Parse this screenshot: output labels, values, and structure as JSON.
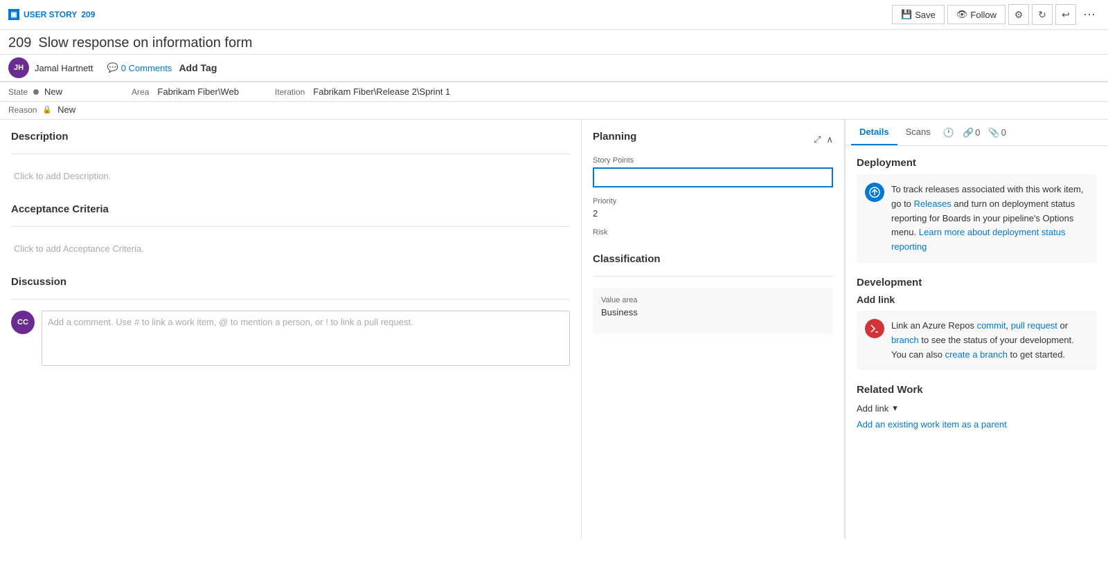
{
  "workItem": {
    "type": "USER STORY",
    "number": "209",
    "title": "Slow response on information form",
    "assignee": "Jamal Hartnett",
    "assigneeInitials": "JH",
    "commentsCount": "0 Comments",
    "addTagLabel": "Add Tag"
  },
  "state": {
    "label": "State",
    "dot": true,
    "value": "New",
    "reasonLabel": "Reason",
    "reasonIcon": "lock",
    "reasonValue": "New",
    "areaLabel": "Area",
    "areaValue": "Fabrikam Fiber\\Web",
    "iterationLabel": "Iteration",
    "iterationValue": "Fabrikam Fiber\\Release 2\\Sprint 1"
  },
  "toolbar": {
    "saveLabel": "Save",
    "followLabel": "Follow",
    "settingsIcon": "⚙",
    "refreshIcon": "↻",
    "undoIcon": "↩",
    "moreIcon": "⋯"
  },
  "tabs": {
    "details": "Details",
    "scans": "Scans",
    "history": "🕐",
    "links": "0",
    "attachments": "0"
  },
  "description": {
    "title": "Description",
    "placeholder": "Click to add Description."
  },
  "acceptanceCriteria": {
    "title": "Acceptance Criteria",
    "placeholder": "Click to add Acceptance Criteria."
  },
  "discussion": {
    "title": "Discussion",
    "avatarInitials": "CC",
    "placeholder": "Add a comment. Use # to link a work item, @ to mention a person, or ! to link a pull request."
  },
  "planning": {
    "title": "Planning",
    "storyPointsLabel": "Story Points",
    "storyPointsValue": "",
    "priorityLabel": "Priority",
    "priorityValue": "2",
    "riskLabel": "Risk",
    "riskValue": ""
  },
  "classification": {
    "title": "Classification",
    "valueAreaLabel": "Value area",
    "valueAreaValue": "Business"
  },
  "deployment": {
    "sectionTitle": "Deployment",
    "bodyText": "To track releases associated with this work item, go to Releases and turn on deployment status reporting for Boards in your pipeline's Options menu. Learn more about deployment status reporting",
    "releasesLinkText": "Releases",
    "learnMoreText": "Learn more about deployment status reporting"
  },
  "development": {
    "sectionTitle": "Development",
    "addLinkLabel": "Add link",
    "bodyText": "Link an Azure Repos commit, pull request or branch to see the status of your development. You can also create a branch to get started.",
    "commitLinkText": "commit",
    "pullRequestLinkText": "pull request",
    "branchLinkText": "branch",
    "createBranchLinkText": "create a branch"
  },
  "relatedWork": {
    "sectionTitle": "Related Work",
    "addLinkLabel": "Add link",
    "addExistingParentText": "Add an existing work item as a parent"
  }
}
